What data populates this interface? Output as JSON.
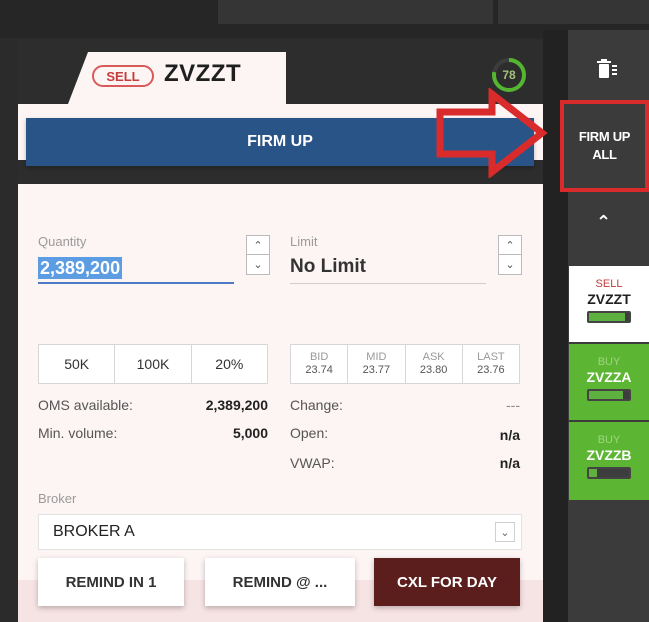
{
  "ticket": {
    "side": "SELL",
    "symbol": "ZVZZT",
    "timer": "78",
    "timer_progress": 0.78,
    "firm_up_label": "FIRM UP",
    "quantity": {
      "label": "Quantity",
      "value": "2,389,200"
    },
    "limit": {
      "label": "Limit",
      "value": "No Limit"
    },
    "quick_qty": [
      "50K",
      "100K",
      "20%"
    ],
    "prices": [
      {
        "label": "BID",
        "value": "23.74"
      },
      {
        "label": "MID",
        "value": "23.77"
      },
      {
        "label": "ASK",
        "value": "23.80"
      },
      {
        "label": "LAST",
        "value": "23.76"
      }
    ],
    "stats_left": [
      {
        "label": "OMS available:",
        "value": "2,389,200"
      },
      {
        "label": "Min. volume:",
        "value": "5,000"
      }
    ],
    "stats_right": [
      {
        "label": "Change:",
        "value": "---"
      },
      {
        "label": "Open:",
        "value": "n/a"
      },
      {
        "label": "VWAP:",
        "value": "n/a"
      }
    ],
    "broker": {
      "label": "Broker",
      "value": "BROKER A"
    },
    "actions": {
      "remind_in": "REMIND IN 1",
      "remind_at": "REMIND @ ...",
      "cxl_for_day": "CXL FOR DAY"
    }
  },
  "sidebar": {
    "firm_up_all_line1": "FIRM UP",
    "firm_up_all_line2": "ALL",
    "orders": [
      {
        "side": "SELL",
        "symbol": "ZVZZT",
        "progress": 0.9,
        "bg": "#ffffff",
        "side_color": "#c63b3b",
        "symbol_color": "#1f1f1f"
      },
      {
        "side": "BUY",
        "symbol": "ZVZZA",
        "progress": 0.85,
        "bg": "#5cb533",
        "side_color": "#9ed67e",
        "symbol_color": "#ffffff"
      },
      {
        "side": "BUY",
        "symbol": "ZVZZB",
        "progress": 0.2,
        "bg": "#5cb533",
        "side_color": "#9ed67e",
        "symbol_color": "#ffffff"
      }
    ]
  },
  "colors": {
    "firm_up": "#295488",
    "sell": "#c63b3b",
    "buy": "#5cb533",
    "annotation": "#d92b2b"
  }
}
